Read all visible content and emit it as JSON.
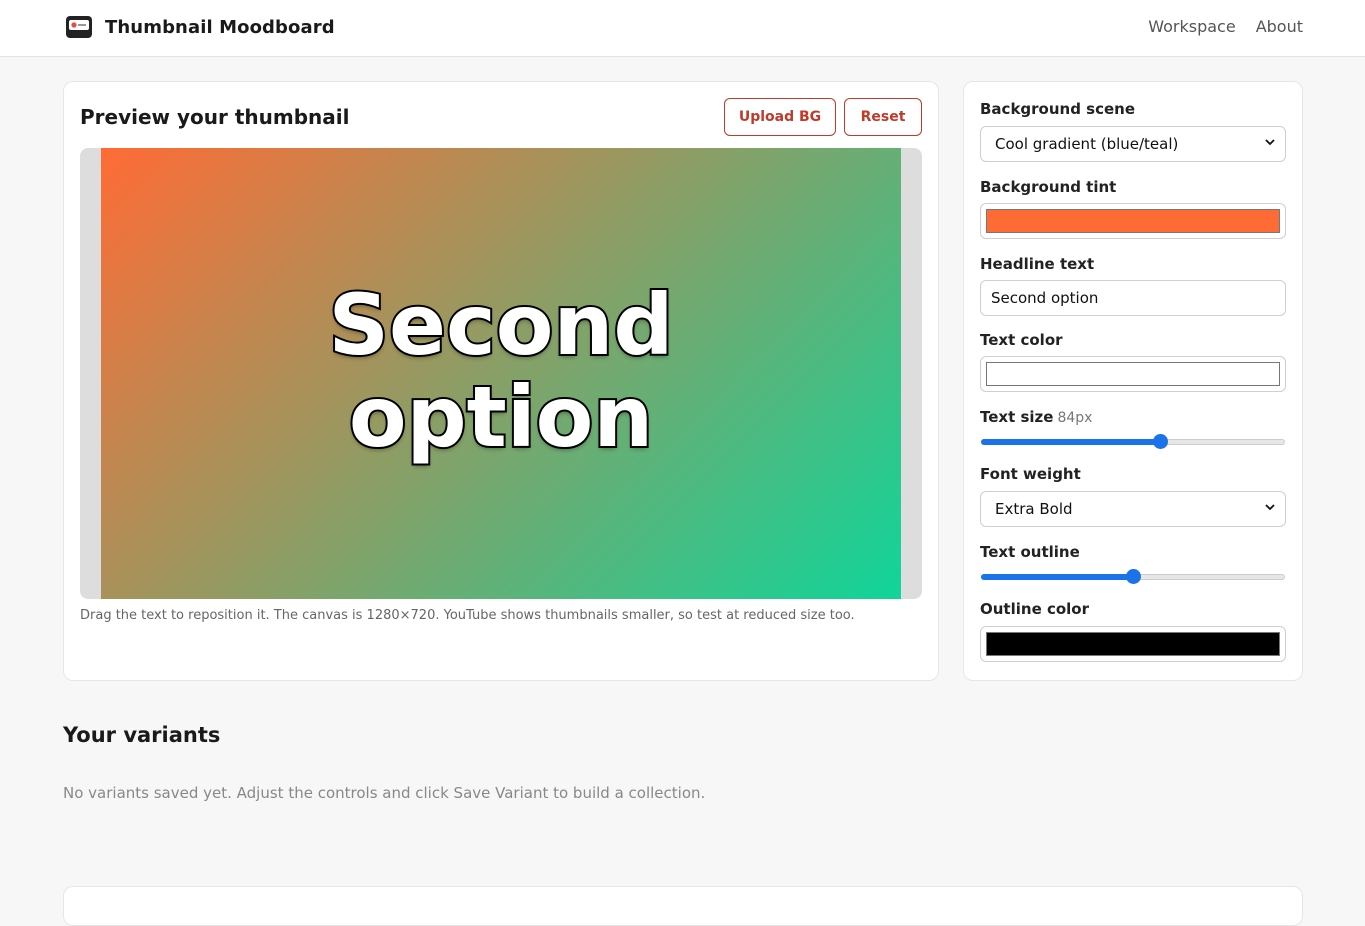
{
  "app": {
    "title": "Thumbnail Moodboard",
    "icon": "thumbnail-icon"
  },
  "nav": {
    "items": [
      "Workspace",
      "About"
    ]
  },
  "preview": {
    "title": "Preview your thumbnail",
    "upload_label": "Upload BG",
    "reset_label": "Reset",
    "headline_text": "Second option",
    "hint": "Drag the text to reposition it. The canvas is 1280×720. YouTube shows thumbnails smaller, so test at reduced size too."
  },
  "controls": {
    "background_scene": {
      "label": "Background scene",
      "value": "Cool gradient (blue/teal)"
    },
    "background_tint": {
      "label": "Background tint",
      "value": "#ff6b35"
    },
    "headline_text": {
      "label": "Headline text",
      "value": "Second option"
    },
    "text_color": {
      "label": "Text color",
      "value": "#ffffff"
    },
    "text_size": {
      "label": "Text size",
      "value_label": "84px",
      "fraction": 0.59
    },
    "font_weight": {
      "label": "Font weight",
      "value": "Extra Bold"
    },
    "text_outline": {
      "label": "Text outline",
      "fraction": 0.5
    },
    "outline_color": {
      "label": "Outline color",
      "value": "#000000"
    }
  },
  "variants": {
    "title": "Your variants",
    "empty_message": "No variants saved yet. Adjust the controls and click Save Variant to build a collection."
  },
  "colors": {
    "accent": "#c0392b",
    "slider": "#1a73e8",
    "gradient_start": "#ff6b35",
    "gradient_end": "#10d59a"
  }
}
